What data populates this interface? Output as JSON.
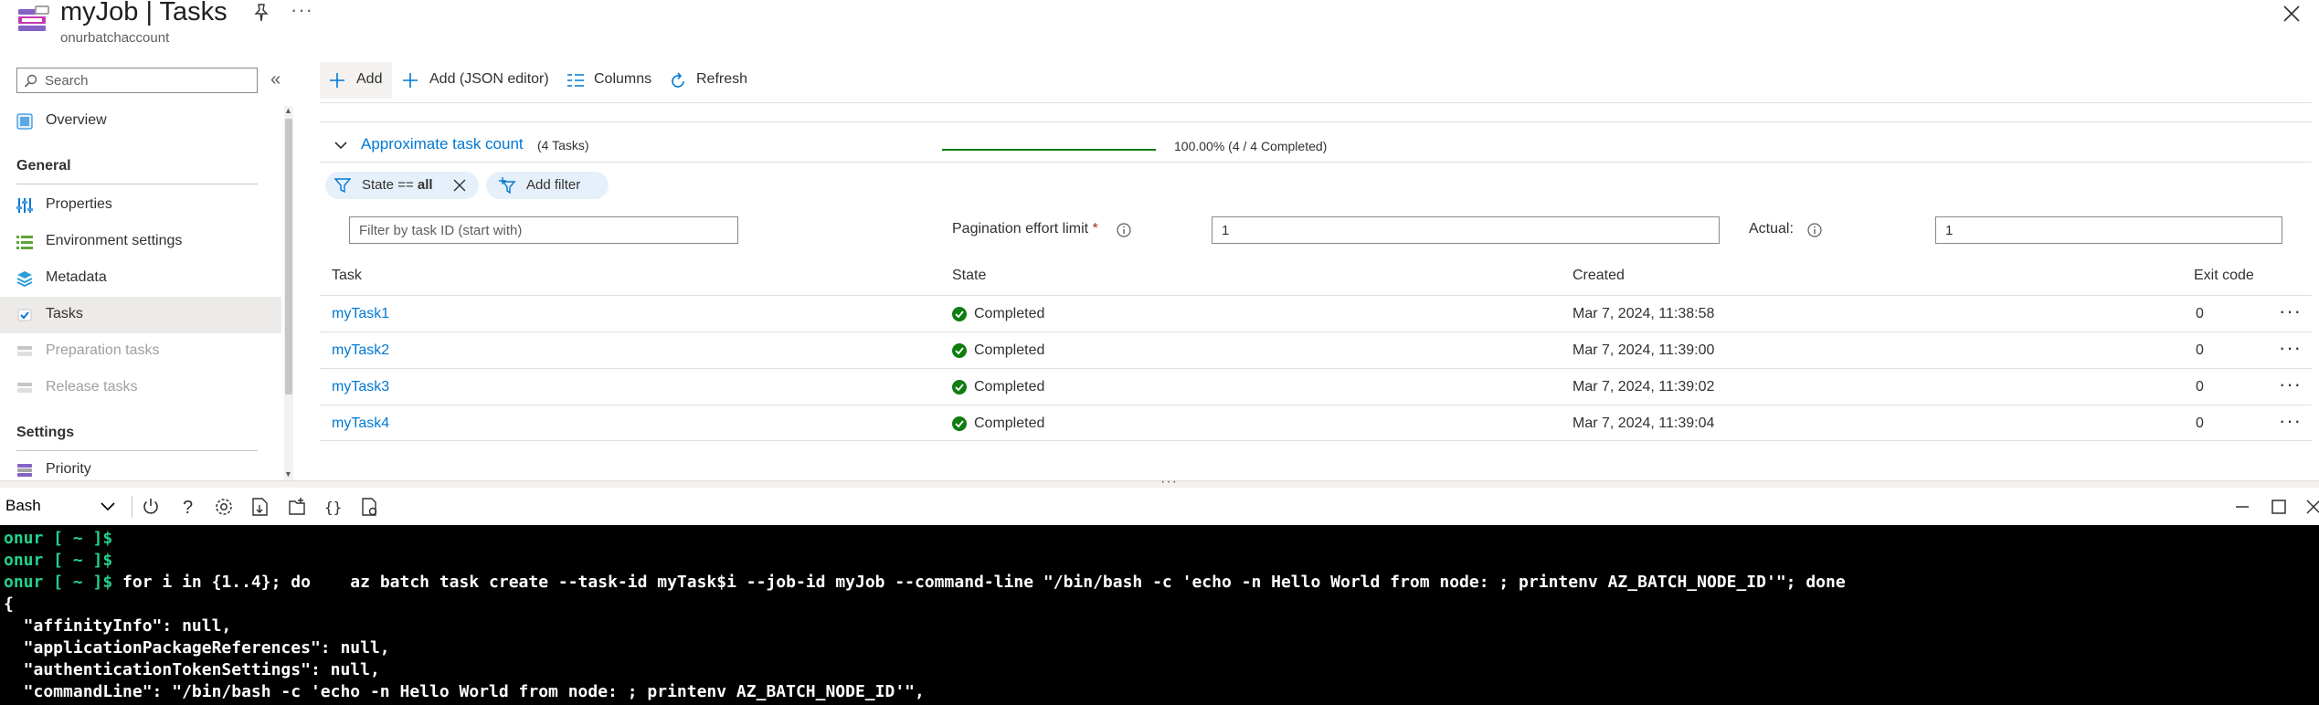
{
  "header": {
    "title": "myJob | Tasks",
    "subtitle": "onurbatchaccount"
  },
  "sidebar": {
    "search_placeholder": "Search",
    "items": [
      {
        "label": "Overview",
        "icon": "overview-icon"
      },
      {
        "label": "Properties",
        "icon": "properties-icon"
      },
      {
        "label": "Environment settings",
        "icon": "environment-settings-icon"
      },
      {
        "label": "Metadata",
        "icon": "metadata-icon"
      },
      {
        "label": "Tasks",
        "icon": "tasks-icon",
        "active": true
      },
      {
        "label": "Preparation tasks",
        "icon": "preparation-tasks-icon",
        "disabled": true
      },
      {
        "label": "Release tasks",
        "icon": "release-tasks-icon",
        "disabled": true
      },
      {
        "label": "Priority",
        "icon": "priority-icon"
      }
    ],
    "sections": {
      "general": "General",
      "settings": "Settings"
    }
  },
  "toolbar": {
    "add": "Add",
    "add_json": "Add (JSON editor)",
    "columns": "Columns",
    "refresh": "Refresh"
  },
  "approx": {
    "title": "Approximate task count",
    "count": "(4 Tasks)",
    "percent_text": "100.00% (4 / 4 Completed)",
    "progress": 1.0
  },
  "filters": {
    "state_prefix": "State == ",
    "state_value": "all",
    "add_filter": "Add filter",
    "task_id_placeholder": "Filter by task ID (start with)",
    "pagination_label": "Pagination effort limit",
    "pagination_required": "*",
    "pagination_value": "1",
    "actual_label": "Actual:",
    "actual_value": "1"
  },
  "table": {
    "headers": {
      "task": "Task",
      "state": "State",
      "created": "Created",
      "exit_code": "Exit code"
    },
    "rows": [
      {
        "task": "myTask1",
        "state": "Completed",
        "created": "Mar 7, 2024, 11:38:58",
        "exit_code": "0"
      },
      {
        "task": "myTask2",
        "state": "Completed",
        "created": "Mar 7, 2024, 11:39:00",
        "exit_code": "0"
      },
      {
        "task": "myTask3",
        "state": "Completed",
        "created": "Mar 7, 2024, 11:39:02",
        "exit_code": "0"
      },
      {
        "task": "myTask4",
        "state": "Completed",
        "created": "Mar 7, 2024, 11:39:04",
        "exit_code": "0"
      }
    ]
  },
  "shell": {
    "type": "Bash",
    "prompt": "onur [ ~ ]$",
    "lines": [
      {
        "prompt": "onur [ ~ ]$",
        "text": ""
      },
      {
        "prompt": "onur [ ~ ]$",
        "text": ""
      },
      {
        "prompt": "onur [ ~ ]$",
        "text": " for i in {1..4}; do    az batch task create --task-id myTask$i --job-id myJob --command-line \"/bin/bash -c 'echo -n Hello World from node: ; printenv AZ_BATCH_NODE_ID'\"; done"
      },
      {
        "prompt": "",
        "text": "{"
      },
      {
        "prompt": "",
        "text": "  \"affinityInfo\": null,"
      },
      {
        "prompt": "",
        "text": "  \"applicationPackageReferences\": null,"
      },
      {
        "prompt": "",
        "text": "  \"authenticationTokenSettings\": null,"
      },
      {
        "prompt": "",
        "text": "  \"commandLine\": \"/bin/bash -c 'echo -n Hello World from node: ; printenv AZ_BATCH_NODE_ID'\","
      }
    ]
  },
  "colors": {
    "accent": "#0078d4",
    "success": "#107c10",
    "terminal_bg": "#000000",
    "prompt": "#23d18b"
  }
}
